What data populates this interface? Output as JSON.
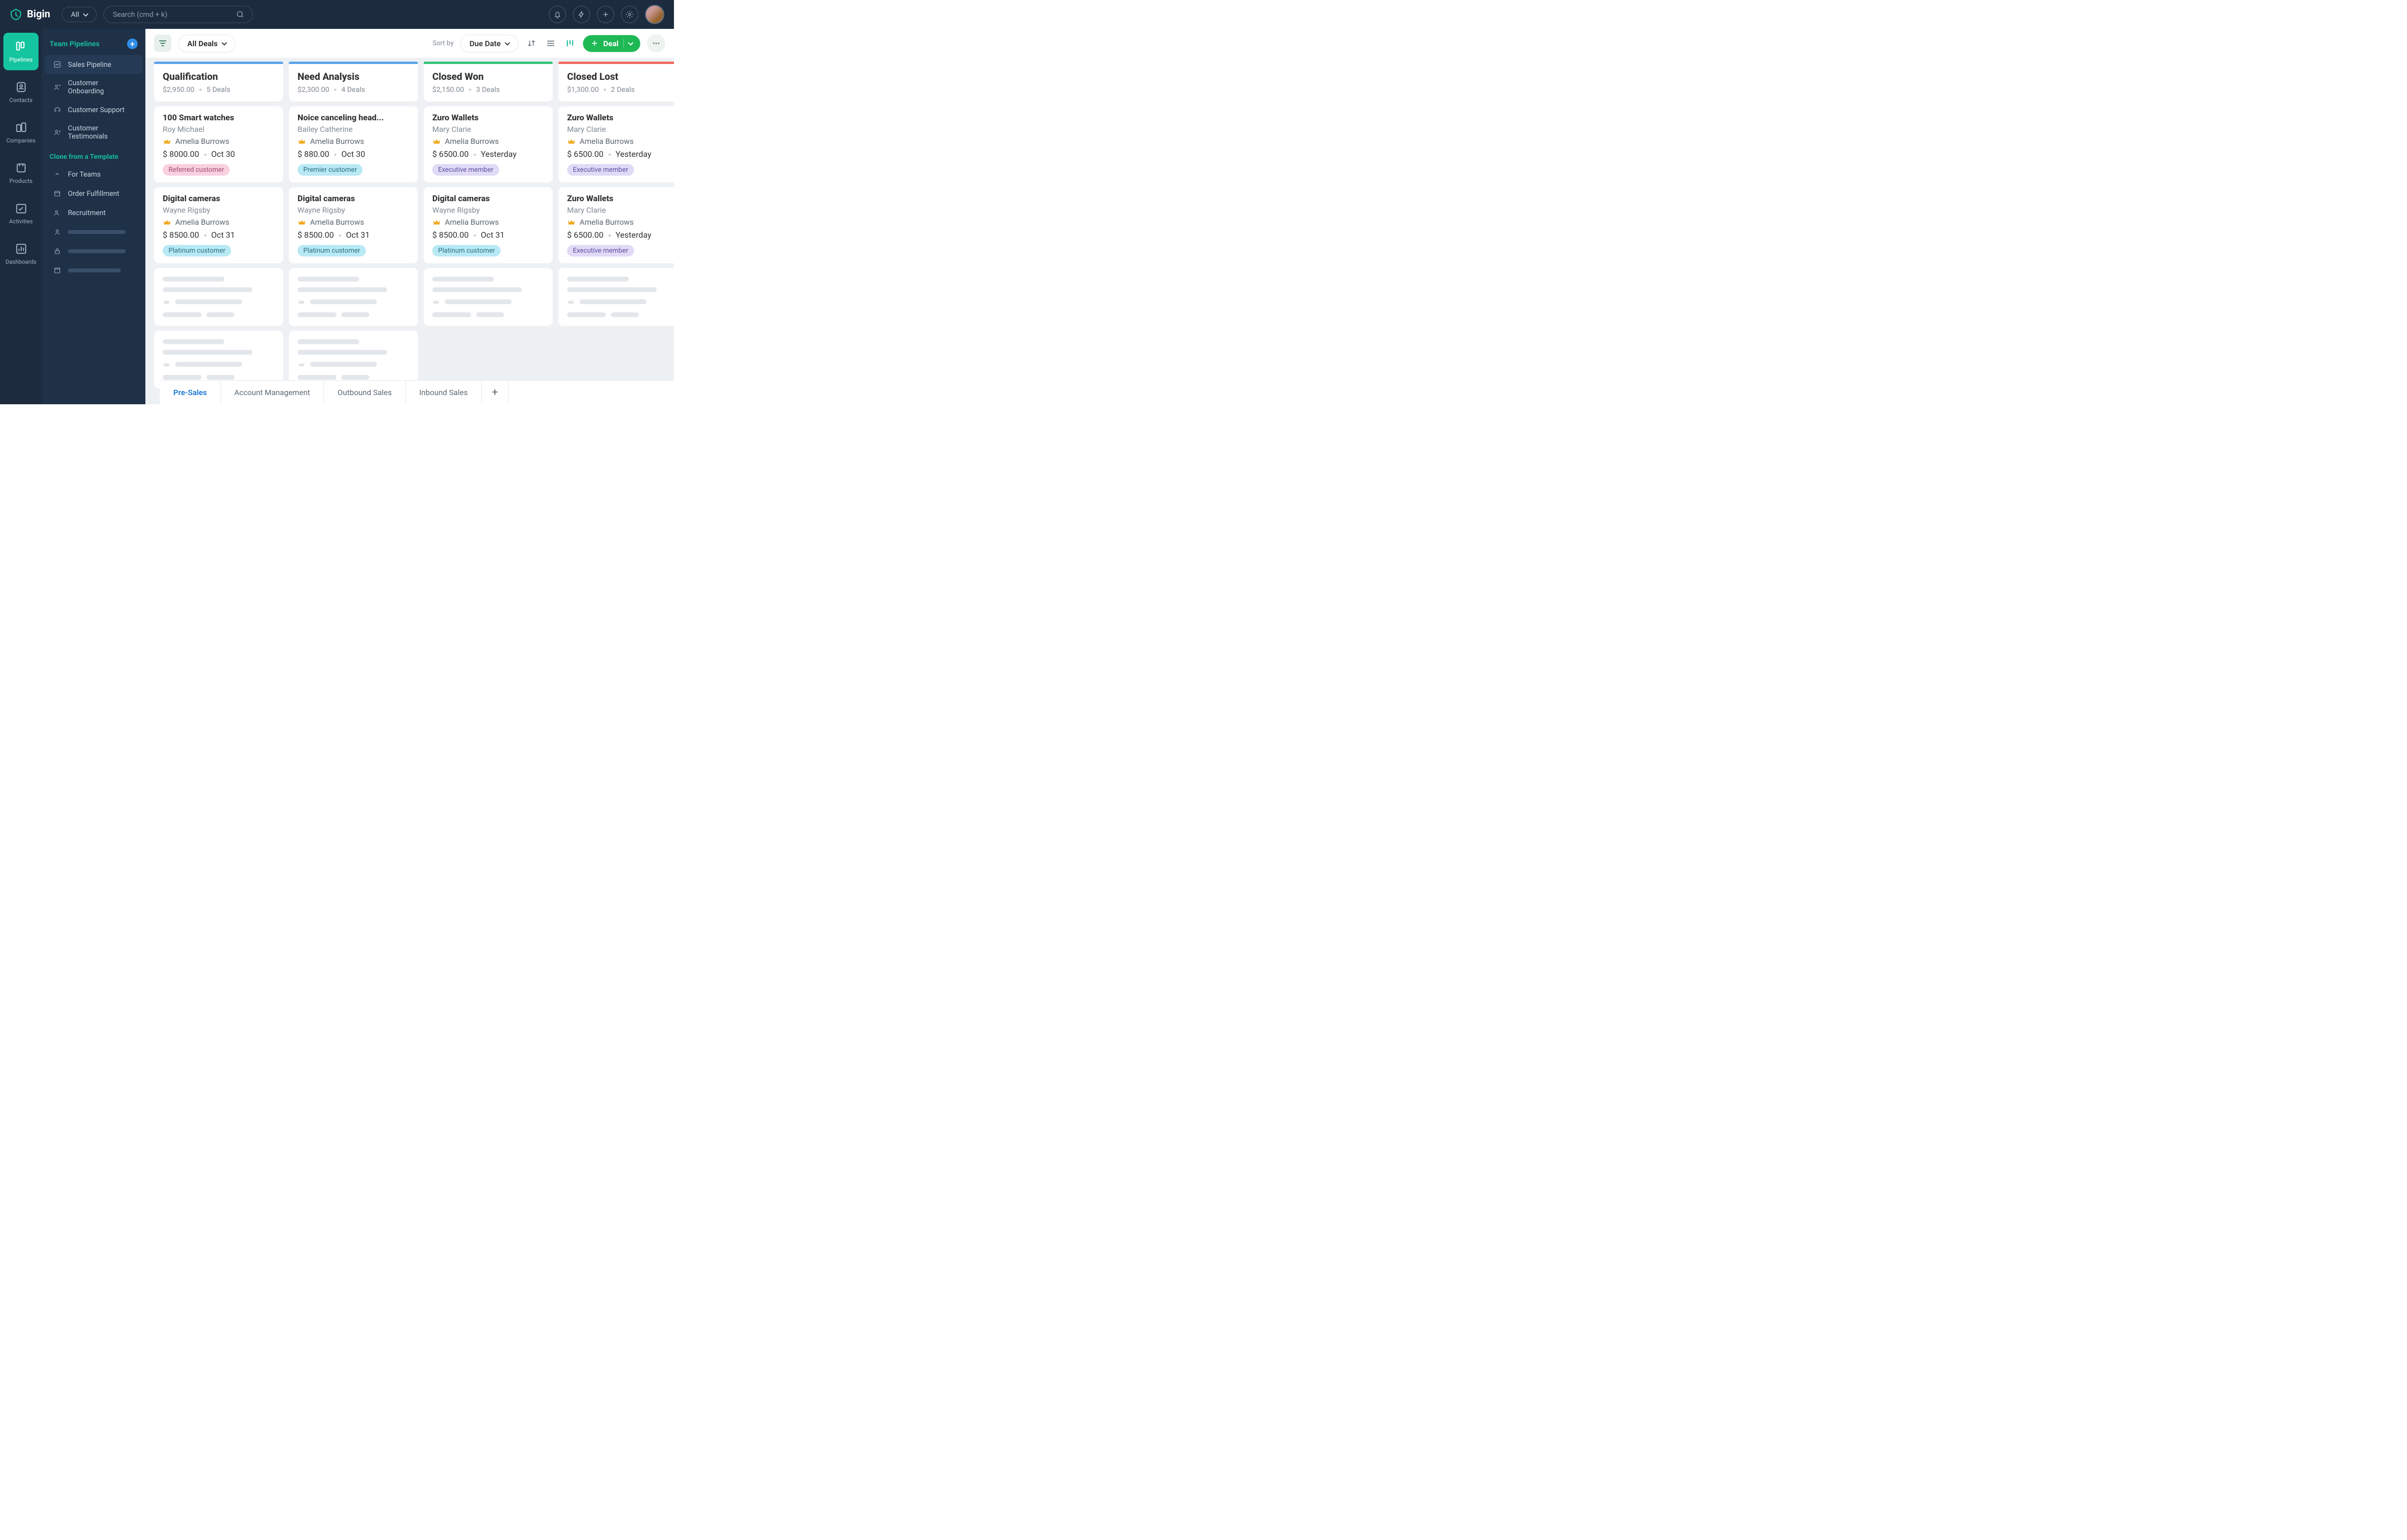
{
  "brand": "Bigin",
  "top": {
    "all_label": "All",
    "search_placeholder": "Search (cmd + k)"
  },
  "rail": [
    {
      "label": "Pipelines"
    },
    {
      "label": "Contacts"
    },
    {
      "label": "Companies"
    },
    {
      "label": "Products"
    },
    {
      "label": "Activities"
    },
    {
      "label": "Dashboards"
    }
  ],
  "side": {
    "heading": "Team Pipelines",
    "items": [
      {
        "label": "Sales Pipeline",
        "active": true
      },
      {
        "label": "Customer Onboarding"
      },
      {
        "label": "Customer Support"
      },
      {
        "label": "Customer Testimonials"
      }
    ],
    "clone_heading": "Clone from a Template",
    "clone": [
      {
        "label": "For Teams"
      },
      {
        "label": "Order Fulfillment"
      },
      {
        "label": "Recruitment"
      }
    ]
  },
  "toolbar": {
    "dropdown": "All Deals",
    "sortby": "Sort by",
    "sort_value": "Due Date",
    "deal": "Deal"
  },
  "columns": [
    {
      "name": "Qualification",
      "total": "$2,950.00",
      "count": "5 Deals",
      "bar": "#5ea4ec",
      "cards": [
        {
          "title": "100 Smart watches",
          "contact": "Roy Michael",
          "owner": "Amelia Burrows",
          "amount": "$ 8000.00",
          "due": "Oct 30",
          "tag": "Referred customer",
          "tag_cls": "pink"
        },
        {
          "title": "Digital cameras",
          "contact": "Wayne Rigsby",
          "owner": "Amelia Burrows",
          "amount": "$ 8500.00",
          "due": "Oct 31",
          "tag": "Platinum customer",
          "tag_cls": "cyan"
        }
      ]
    },
    {
      "name": "Need Analysis",
      "total": "$2,300.00",
      "count": "4 Deals",
      "bar": "#5ea4ec",
      "cards": [
        {
          "title": "Noice canceling head...",
          "contact": "Bailey Catherine",
          "owner": "Amelia Burrows",
          "amount": "$ 880.00",
          "due": "Oct 30",
          "tag": "Premier customer",
          "tag_cls": "cyan"
        },
        {
          "title": "Digital cameras",
          "contact": "Wayne Rigsby",
          "owner": "Amelia Burrows",
          "amount": "$ 8500.00",
          "due": "Oct 31",
          "tag": "Platinum customer",
          "tag_cls": "cyan"
        }
      ]
    },
    {
      "name": "Closed Won",
      "total": "$2,150.00",
      "count": "3 Deals",
      "bar": "#34c47a",
      "cards": [
        {
          "title": "Zuro Wallets",
          "contact": "Mary Clarie",
          "owner": "Amelia Burrows",
          "amount": "$ 6500.00",
          "due": "Yesterday",
          "tag": "Executive member",
          "tag_cls": "lav"
        },
        {
          "title": "Digital cameras",
          "contact": "Wayne Rigsby",
          "owner": "Amelia Burrows",
          "amount": "$ 8500.00",
          "due": "Oct 31",
          "tag": "Platinum customer",
          "tag_cls": "cyan"
        }
      ]
    },
    {
      "name": "Closed Lost",
      "total": "$1,300.00",
      "count": "2 Deals",
      "bar": "#ef6a60",
      "cards": [
        {
          "title": "Zuro Wallets",
          "contact": "Mary Clarie",
          "owner": "Amelia Burrows",
          "amount": "$ 6500.00",
          "due": "Yesterday",
          "tag": "Executive member",
          "tag_cls": "lav"
        },
        {
          "title": "Zuro Wallets",
          "contact": "Mary Clarie",
          "owner": "Amelia Burrows",
          "amount": "$ 6500.00",
          "due": "Yesterday",
          "tag": "Executive member",
          "tag_cls": "lav"
        }
      ]
    }
  ],
  "tabs": [
    "Pre-Sales",
    "Account Management",
    "Outbound Sales",
    "Inbound Sales"
  ]
}
